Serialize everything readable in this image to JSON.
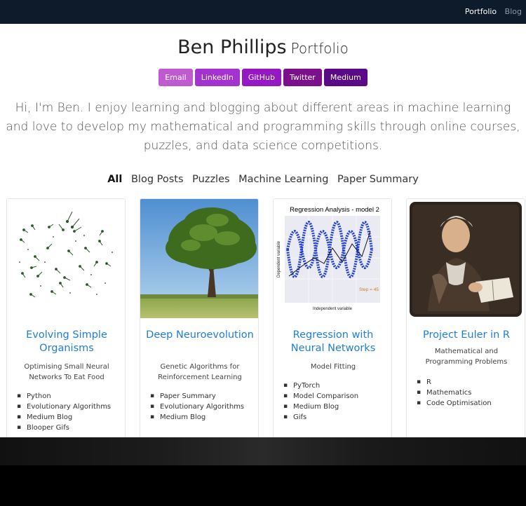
{
  "navbar": {
    "links": [
      "Portfolio",
      "Blog"
    ]
  },
  "header": {
    "name": "Ben Phillips",
    "subtitle": "Portfolio"
  },
  "badges": [
    {
      "label": "Email",
      "color": "#c05ad0"
    },
    {
      "label": "LinkedIn",
      "color": "#a332cf"
    },
    {
      "label": "GitHub",
      "color": "#9618c4"
    },
    {
      "label": "Twitter",
      "color": "#7c0f8c"
    },
    {
      "label": "Medium",
      "color": "#5a0a86"
    }
  ],
  "intro": "Hi, I'm Ben. I enjoy learning and blogging about different areas in machine learning and love to develop my mathematical and programming skills through online courses, puzzles, and data science competitions.",
  "filters": [
    "All",
    "Blog Posts",
    "Puzzles",
    "Machine Learning",
    "Paper Summary"
  ],
  "cards": [
    {
      "title": "Evolving Simple Organisms",
      "description": "Optimising Small Neural Networks To Eat Food",
      "tags": [
        "Python",
        "Evolutionary Algorithms",
        "Medium Blog",
        "Blooper Gifs"
      ]
    },
    {
      "title": "Deep Neuroevolution",
      "description": "Genetic Algorithms for Reinforcement Learning",
      "tags": [
        "Paper Summary",
        "Evolutionary Algorithms",
        "Medium Blog"
      ]
    },
    {
      "title": "Regression with Neural Networks",
      "description": "Model Fitting",
      "tags": [
        "PyTorch",
        "Model Comparison",
        "Medium Blog",
        "Gifs"
      ],
      "image_text": {
        "plot_title": "Regression Analysis - model 2",
        "ylabel": "Dependent variable",
        "xlabel": "Independent variable",
        "step": "Step = 45"
      }
    },
    {
      "title": "Project Euler in R",
      "description": "Mathematical and Programming Problems",
      "tags": [
        "R",
        "Mathematics",
        "Code Optimisation"
      ]
    }
  ]
}
